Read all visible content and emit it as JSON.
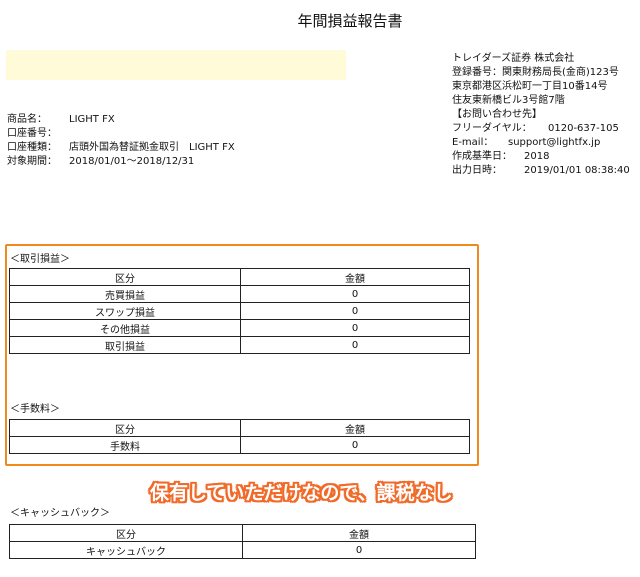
{
  "title": "年間損益報告書",
  "company": {
    "name": "トレイダーズ証券 株式会社",
    "reg_label": "登録番号：",
    "reg_value": "関東財務局長(金商)123号",
    "address1": "東京都港区浜松町一丁目10番14号",
    "address2": "住友東新橋ビル3号館7階",
    "contact_heading": "【お問い合わせ先】",
    "free_dial_label": "フリーダイヤル：",
    "free_dial_value": "0120-637-105",
    "email_label": "E-mail：",
    "email_value": "support@lightfx.jp",
    "created_label": "作成基準日：",
    "created_value": "2018",
    "output_label": "出力日時：",
    "output_value": "2019/01/01 08:38:40"
  },
  "product": {
    "rows": [
      {
        "label": "商品名：",
        "value": "LIGHT FX"
      },
      {
        "label": "口座番号：",
        "value": ""
      },
      {
        "label": "口座種類：",
        "value": "店頭外国為替証拠金取引　LIGHT FX"
      },
      {
        "label": "対象期間：",
        "value": "2018/01/01～2018/12/31"
      }
    ]
  },
  "sections": {
    "trade": {
      "title": "＜取引損益＞",
      "header": [
        "区分",
        "金額"
      ],
      "rows": [
        [
          "売買損益",
          "0"
        ],
        [
          "スワップ損益",
          "0"
        ],
        [
          "その他損益",
          "0"
        ],
        [
          "取引損益",
          "0"
        ]
      ]
    },
    "fee": {
      "title": "＜手数料＞",
      "header": [
        "区分",
        "金額"
      ],
      "rows": [
        [
          "手数料",
          "0"
        ]
      ]
    },
    "cashback": {
      "title": "＜キャッシュバック＞",
      "header": [
        "区分",
        "金額"
      ],
      "rows": [
        [
          "キャッシュバック",
          "0"
        ]
      ]
    }
  },
  "annotation": "保有していただけなので、課税なし",
  "colors": {
    "highlight": "#fffbd8",
    "frame": "#f08a1c",
    "banner": "#f06a2a"
  }
}
